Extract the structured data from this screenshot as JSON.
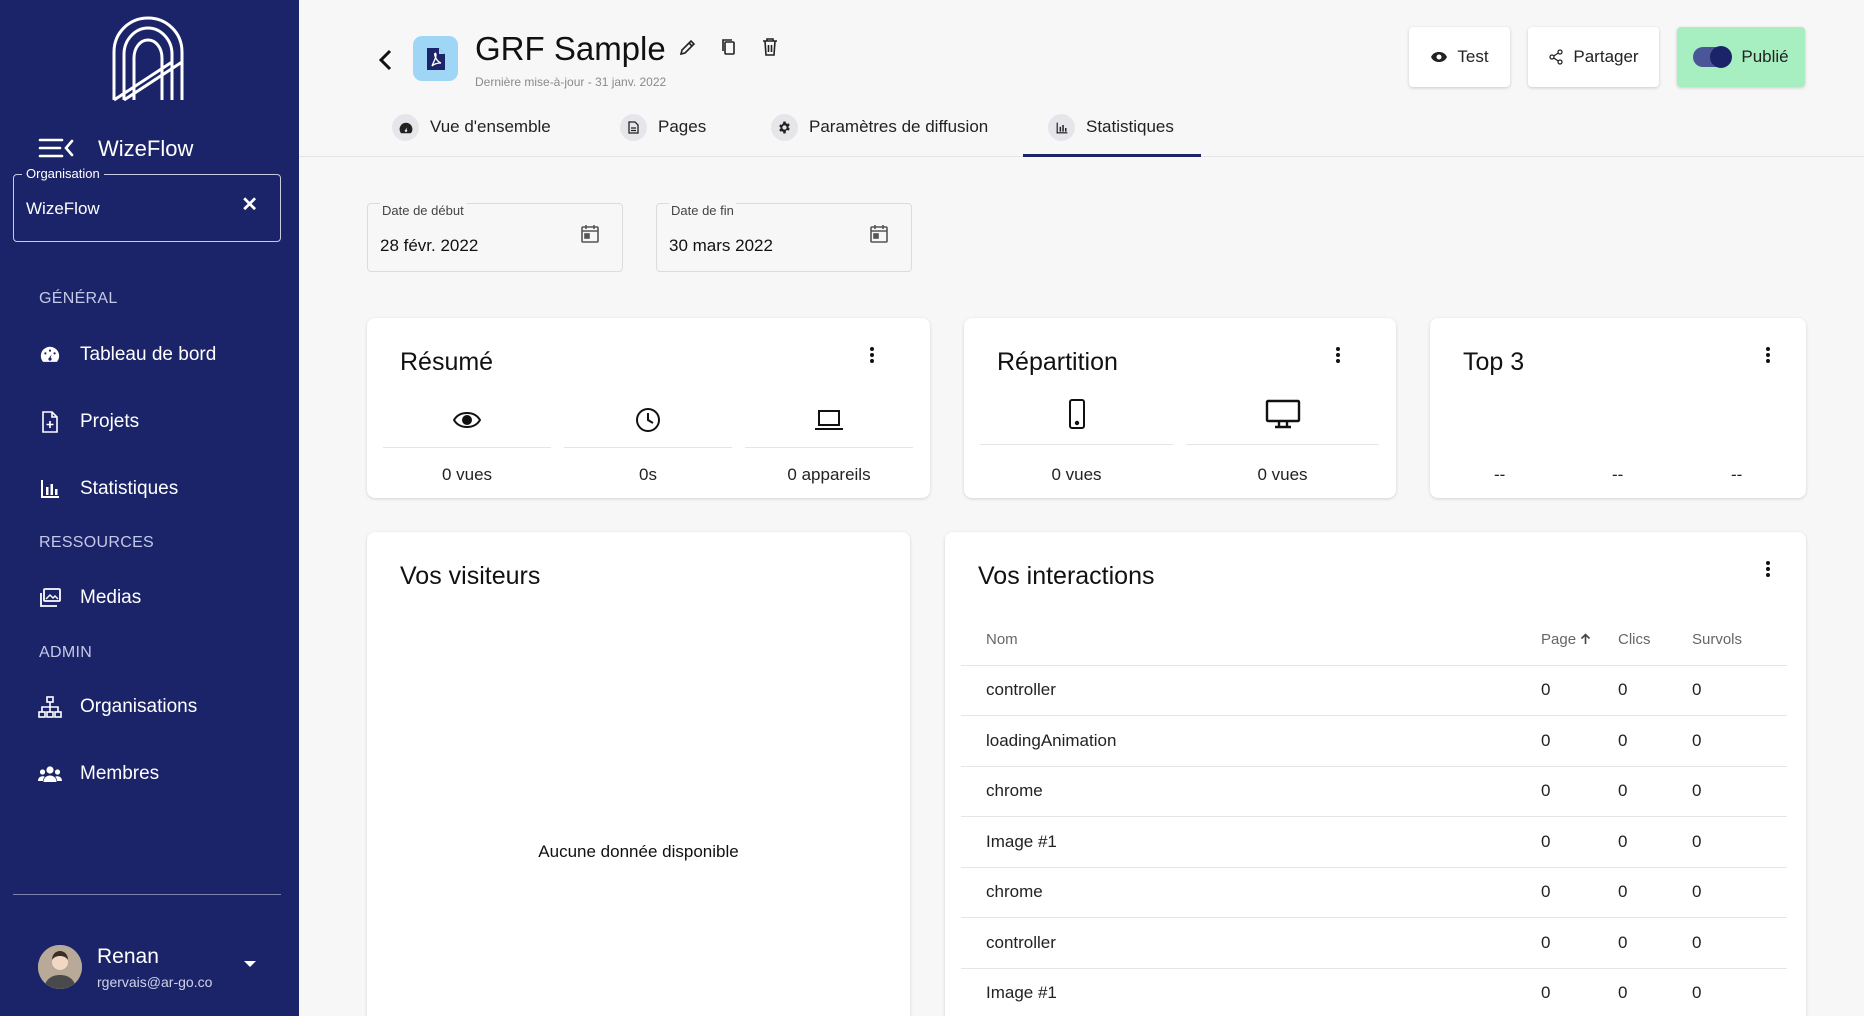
{
  "sidebar": {
    "brand": "WizeFlow",
    "organisation": {
      "label": "Organisation",
      "value": "WizeFlow"
    },
    "sections": {
      "general": "GÉNÉRAL",
      "ressources": "RESSOURCES",
      "admin": "ADMIN"
    },
    "items": {
      "dashboard": "Tableau de bord",
      "projects": "Projets",
      "stats": "Statistiques",
      "medias": "Medias",
      "orgs": "Organisations",
      "members": "Membres"
    },
    "user": {
      "name": "Renan",
      "email": "rgervais@ar-go.co"
    }
  },
  "header": {
    "title": "GRF Sample",
    "subtitle": "Dernière mise-à-jour - 31 janv. 2022",
    "buttons": {
      "test": "Test",
      "share": "Partager",
      "published": "Publié"
    },
    "tabs": {
      "overview": "Vue d'ensemble",
      "pages": "Pages",
      "settings": "Paramètres de diffusion",
      "stats": "Statistiques"
    },
    "active_tab": "Statistiques"
  },
  "filters": {
    "start": {
      "label": "Date de début",
      "value": "28 févr. 2022"
    },
    "end": {
      "label": "Date de fin",
      "value": "30 mars 2022"
    }
  },
  "summary": {
    "title": "Résumé",
    "views": "0  vues",
    "time": "0s",
    "devices": "0  appareils"
  },
  "distribution": {
    "title": "Répartition",
    "mobile": "0  vues",
    "desktop": "0  vues"
  },
  "top3": {
    "title": "Top 3",
    "values": [
      "--",
      "--",
      "--"
    ]
  },
  "visitors": {
    "title": "Vos visiteurs",
    "empty": "Aucune donnée disponible"
  },
  "interactions": {
    "title": "Vos interactions",
    "columns": [
      "Nom",
      "Page",
      "Clics",
      "Survols"
    ],
    "rows": [
      [
        "controller",
        "0",
        "0",
        "0"
      ],
      [
        "loadingAnimation",
        "0",
        "0",
        "0"
      ],
      [
        "chrome",
        "0",
        "0",
        "0"
      ],
      [
        "Image #1",
        "0",
        "0",
        "0"
      ],
      [
        "chrome",
        "0",
        "0",
        "0"
      ],
      [
        "controller",
        "0",
        "0",
        "0"
      ],
      [
        "Image #1",
        "0",
        "0",
        "0"
      ]
    ]
  },
  "colors": {
    "sidebar": "#1b2468",
    "published": "#a7efc0",
    "file_icon_bg": "#9fd6f6"
  }
}
